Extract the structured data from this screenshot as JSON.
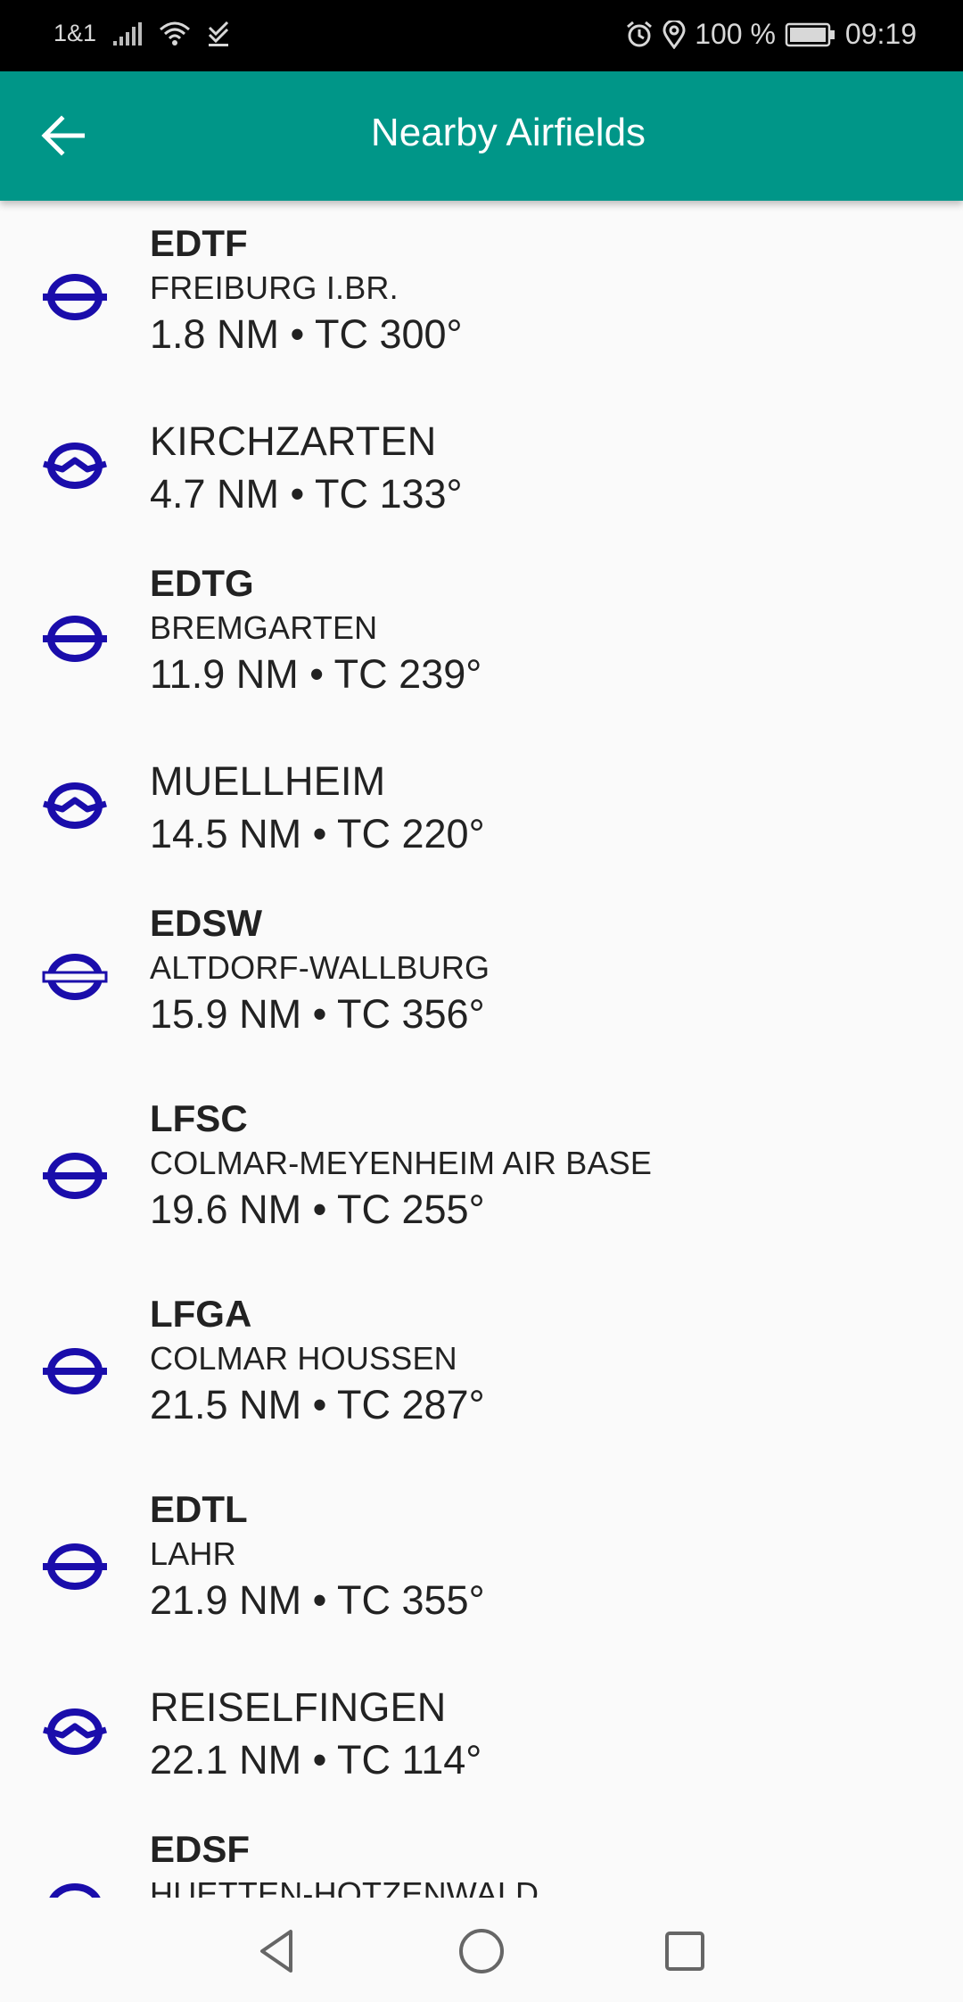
{
  "status_bar": {
    "carrier": "1&1",
    "battery": "100 %",
    "time": "09:19",
    "icons": [
      "signal-icon",
      "wifi-icon",
      "download-done-icon",
      "alarm-icon",
      "location-icon",
      "battery-icon"
    ]
  },
  "app_bar": {
    "title": "Nearby Airfields",
    "back_icon": "arrow-back-icon",
    "color": "#009688"
  },
  "colors": {
    "icon_blue": "#1a0dab",
    "text": "#222222",
    "background": "#fafafa"
  },
  "airfields": [
    {
      "ident": "EDTF",
      "name": "FREIBURG I.BR.",
      "dist": "1.8 NM • TC 300°",
      "icon": "airport-icon"
    },
    {
      "ident": "",
      "name": "KIRCHZARTEN",
      "dist": "4.7 NM • TC 133°",
      "icon": "glider-site-icon"
    },
    {
      "ident": "EDTG",
      "name": "BREMGARTEN",
      "dist": "11.9 NM • TC 239°",
      "icon": "airport-icon"
    },
    {
      "ident": "",
      "name": "MUELLHEIM",
      "dist": "14.5 NM • TC 220°",
      "icon": "glider-site-icon"
    },
    {
      "ident": "EDSW",
      "name": "ALTDORF-WALLBURG",
      "dist": "15.9 NM • TC 356°",
      "icon": "airfield-icon"
    },
    {
      "ident": "LFSC",
      "name": "COLMAR-MEYENHEIM AIR BASE",
      "dist": "19.6 NM • TC 255°",
      "icon": "airport-icon"
    },
    {
      "ident": "LFGA",
      "name": "COLMAR HOUSSEN",
      "dist": "21.5 NM • TC 287°",
      "icon": "airport-icon"
    },
    {
      "ident": "EDTL",
      "name": "LAHR",
      "dist": "21.9 NM • TC 355°",
      "icon": "airport-icon"
    },
    {
      "ident": "",
      "name": "REISELFINGEN",
      "dist": "22.1 NM • TC 114°",
      "icon": "glider-site-icon"
    },
    {
      "ident": "EDSF",
      "name": "HUETTEN-HOTZENWALD",
      "dist": "",
      "icon": "airport-icon"
    }
  ],
  "nav_bar": {
    "icons": [
      "back-triangle-icon",
      "home-circle-icon",
      "recents-square-icon"
    ]
  }
}
